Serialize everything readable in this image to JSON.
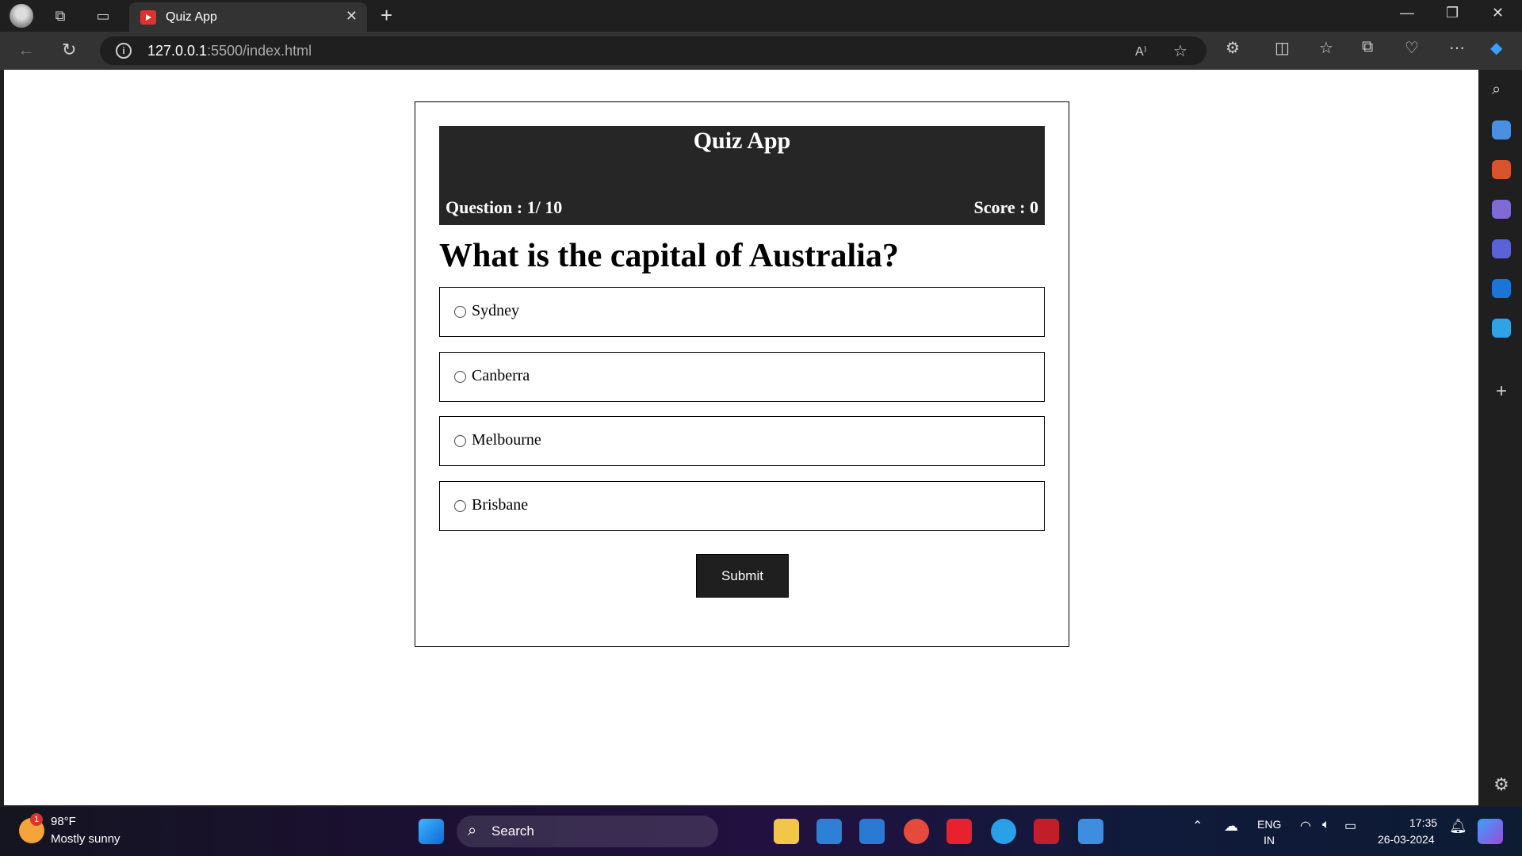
{
  "browser": {
    "tab_title": "Quiz App",
    "url_host": "127.0.0.1",
    "url_rest": ":5500/index.html",
    "read_aloud_label": "A"
  },
  "quiz": {
    "app_title": "Quiz App",
    "question_counter": "Question : 1/ 10",
    "score_text": "Score : 0",
    "question": "What is the capital of Australia?",
    "options": [
      "Sydney",
      "Canberra",
      "Melbourne",
      "Brisbane"
    ],
    "submit_label": "Submit"
  },
  "taskbar": {
    "weather_temp": "98°F",
    "weather_desc": "Mostly sunny",
    "weather_badge": "1",
    "search_label": "Search",
    "lang_primary": "ENG",
    "lang_secondary": "IN",
    "time": "17:35",
    "date": "26-03-2024"
  },
  "colors": {
    "quiz_header_bg": "#262626",
    "submit_bg": "#1f1f1f",
    "favicon": "#e0312f"
  }
}
